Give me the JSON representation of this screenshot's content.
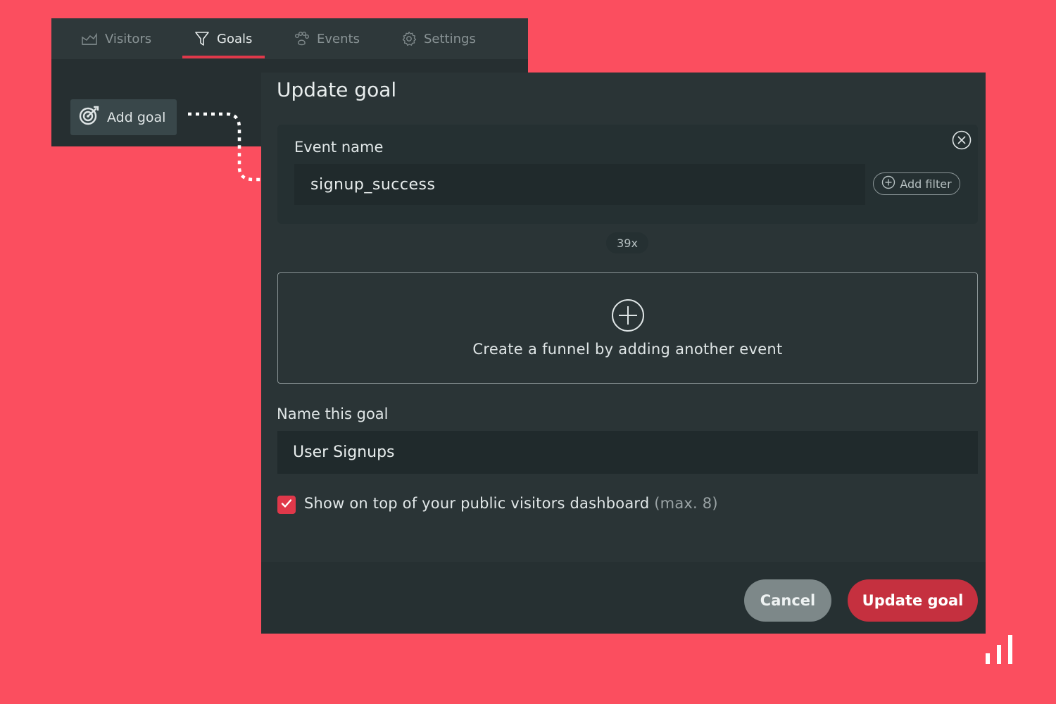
{
  "tabs": [
    {
      "label": "Visitors",
      "icon": "chart-area-icon",
      "active": false
    },
    {
      "label": "Goals",
      "icon": "funnel-icon",
      "active": true
    },
    {
      "label": "Events",
      "icon": "paw-icon",
      "active": false
    },
    {
      "label": "Settings",
      "icon": "gear-icon",
      "active": false
    }
  ],
  "add_goal": {
    "label": "Add goal",
    "icon": "target-icon"
  },
  "modal": {
    "title": "Update goal",
    "event_label": "Event name",
    "event_value": "signup_success",
    "add_filter_label": "Add filter",
    "count_badge": "39x",
    "funnel_text": "Create a funnel by adding another event",
    "name_label": "Name this goal",
    "name_value": "User Signups",
    "checkbox_checked": true,
    "checkbox_label": "Show on top of your public visitors dashboard",
    "checkbox_hint": "(max. 8)",
    "cancel_label": "Cancel",
    "submit_label": "Update goal"
  },
  "colors": {
    "background": "#fb4e5f",
    "panel": "#2a3436",
    "accent": "#e0384a",
    "primary_button": "#c5303f",
    "secondary_button": "#7d8889"
  }
}
